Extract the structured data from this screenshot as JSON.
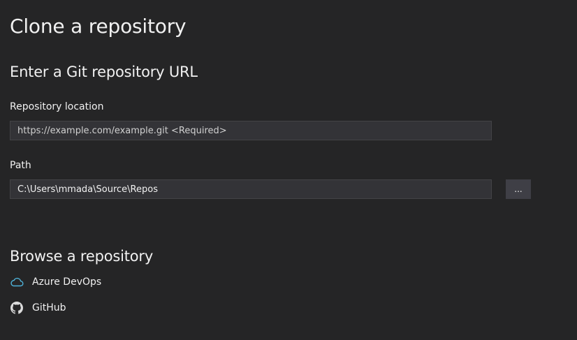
{
  "page": {
    "title": "Clone a repository"
  },
  "git_url_section": {
    "heading": "Enter a Git repository URL",
    "repository_location": {
      "label": "Repository location",
      "value": "",
      "placeholder": "https://example.com/example.git <Required>"
    },
    "path": {
      "label": "Path",
      "value": "C:\\Users\\mmada\\Source\\Repos",
      "browse_label": "..."
    }
  },
  "browse_section": {
    "heading": "Browse a repository",
    "providers": [
      {
        "label": "Azure DevOps",
        "icon": "cloud-icon",
        "icon_color": "#4fb3d9"
      },
      {
        "label": "GitHub",
        "icon": "github-icon",
        "icon_color": "#dcdcdc"
      }
    ]
  },
  "colors": {
    "background": "#252526",
    "input_background": "#333337",
    "input_border": "#434346",
    "button_background": "#3f3f46",
    "text": "#f1f1f1"
  }
}
